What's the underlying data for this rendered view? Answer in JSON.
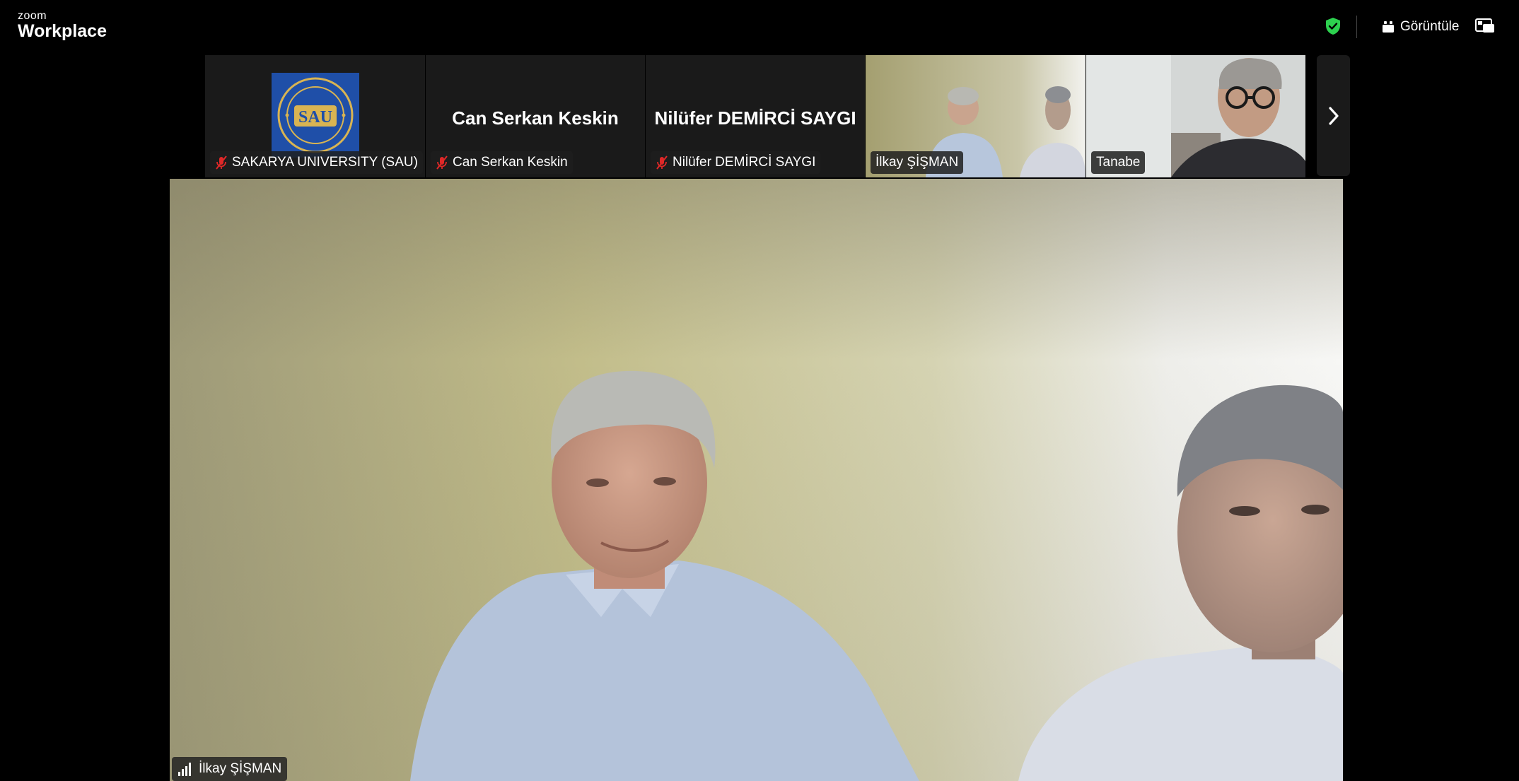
{
  "app": {
    "brand_small": "zoom",
    "brand_large": "Workplace",
    "security_status_color": "#2dd14f",
    "view_label": "Görüntüle"
  },
  "participants": [
    {
      "name": "SAKARYA UNIVERSITY (SAU)",
      "muted": true,
      "avatar": "logo",
      "logo_text": "SAU"
    },
    {
      "name": "Can Serkan Keskin",
      "muted": true,
      "avatar": "name"
    },
    {
      "name": "Nilüfer DEMİRCİ SAYGI",
      "muted": true,
      "avatar": "name"
    },
    {
      "name": "İlkay ŞİŞMAN",
      "muted": false,
      "avatar": "video",
      "active_speaker": true
    },
    {
      "name": "Tanabe",
      "muted": false,
      "avatar": "video"
    }
  ],
  "main_speaker": {
    "name": "İlkay ŞİŞMAN",
    "signal_icon": "signal-bars-icon"
  },
  "colors": {
    "background": "#000000",
    "tile_bg": "#1a1a1a",
    "active_border": "#2dd14f",
    "muted_icon": "#e02828"
  }
}
